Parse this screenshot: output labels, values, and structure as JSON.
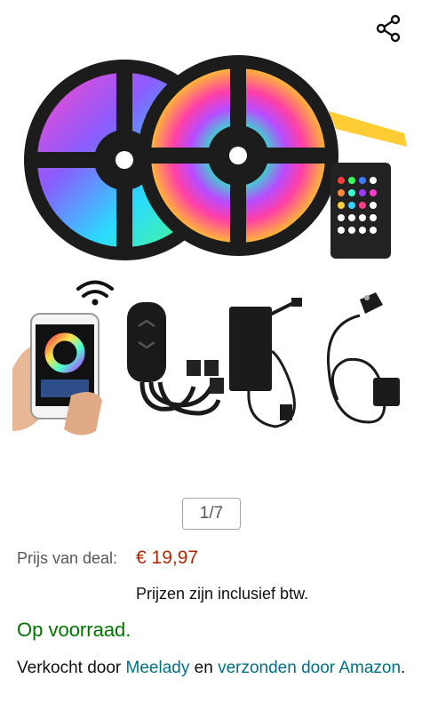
{
  "icons": {
    "share": "share-icon"
  },
  "gallery": {
    "counter": "1/7"
  },
  "price": {
    "label": "Prijs van deal:",
    "value": "€ 19,97",
    "tax_note": "Prijzen zijn inclusief btw."
  },
  "availability": {
    "text": "Op voorraad."
  },
  "seller": {
    "prefix": "Verkocht door ",
    "seller_name": "Meelady",
    "middle": " en ",
    "shipper_link": "verzonden door Amazon",
    "suffix": "."
  },
  "colors": {
    "price": "#b12704",
    "in_stock": "#007600",
    "link": "#007185"
  }
}
